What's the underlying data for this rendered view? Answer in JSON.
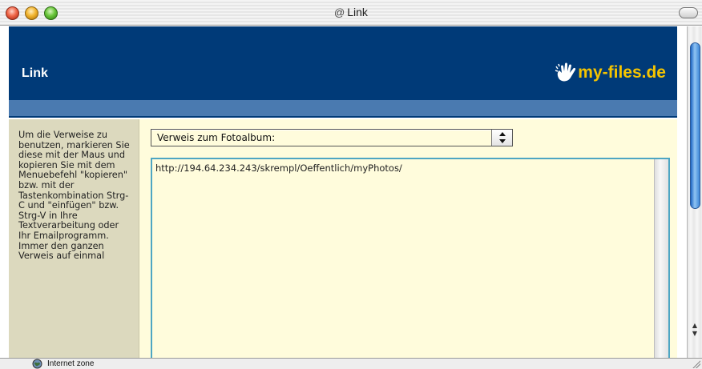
{
  "window": {
    "title": "Link",
    "title_icon": "at-sign-icon"
  },
  "banner": {
    "heading": "Link",
    "logo_text": "my-files.de",
    "background_color": "#003a78",
    "logo_color": "#f5c400"
  },
  "help_text": "Um die Verweise zu benutzen, markieren Sie diese mit der Maus und kopieren Sie mit dem Menuebefehl \"kopieren\" bzw. mit der Tastenkombination Strg-C und \"einfügen\" bzw. Strg-V in Ihre Textverarbeitung oder Ihr Emailprogramm. Immer den ganzen Verweis auf einmal",
  "link_select": {
    "selected": "Verweis zum Fotoalbum:"
  },
  "link_textarea": {
    "value": "http://194.64.234.243/skrempl/Oeffentlich/myPhotos/"
  },
  "status_bar": {
    "zone_text": "Internet zone"
  }
}
